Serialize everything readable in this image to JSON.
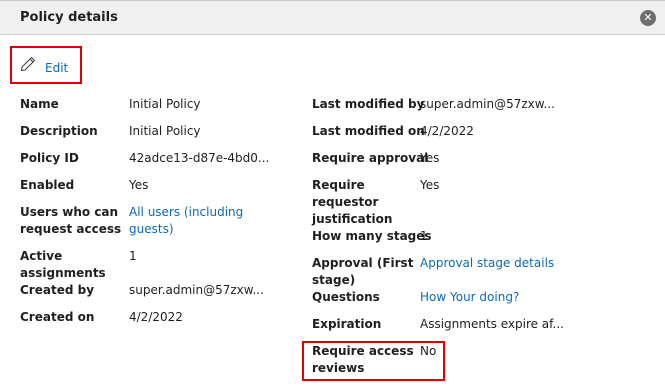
{
  "header": {
    "title": "Policy details",
    "close_icon": "close-circle-icon"
  },
  "edit": {
    "label": "Edit",
    "icon": "pencil-icon"
  },
  "left": {
    "name_label": "Name",
    "name_value": "Initial Policy",
    "description_label": "Description",
    "description_value": "Initial Policy",
    "policy_id_label": "Policy ID",
    "policy_id_value": "42adce13-d87e-4bd0...",
    "enabled_label": "Enabled",
    "enabled_value": "Yes",
    "users_label_1": "Users who can",
    "users_label_2": "request access",
    "users_value_1": "All users (including",
    "users_value_2": "guests)",
    "active_label_1": "Active",
    "active_label_2": "assignments",
    "active_value": "1",
    "created_by_label": "Created by",
    "created_by_value": "super.admin@57zxw...",
    "created_on_label": "Created on",
    "created_on_value": "4/2/2022"
  },
  "right": {
    "last_modified_by_label": "Last modified by",
    "last_modified_by_value": "super.admin@57zxw...",
    "last_modified_on_label": "Last modified on",
    "last_modified_on_value": "4/2/2022",
    "require_approval_label": "Require approval",
    "require_approval_value": "Yes",
    "require_justification_label_1": "Require",
    "require_justification_label_2": "requestor",
    "require_justification_label_3": "justification",
    "require_justification_value": "Yes",
    "stages_label": "How many stages",
    "stages_value": "1",
    "approval_label_1": "Approval (First",
    "approval_label_2": "stage)",
    "approval_value": "Approval stage details",
    "questions_label": "Questions",
    "questions_value": "How Your doing?",
    "expiration_label": "Expiration",
    "expiration_value": "Assignments expire af...",
    "access_reviews_label_1": "Require access",
    "access_reviews_label_2": "reviews",
    "access_reviews_value": "No"
  },
  "colors": {
    "link": "#0b6ab8",
    "highlight": "#e00000",
    "header_bg": "#f0f0f0"
  }
}
